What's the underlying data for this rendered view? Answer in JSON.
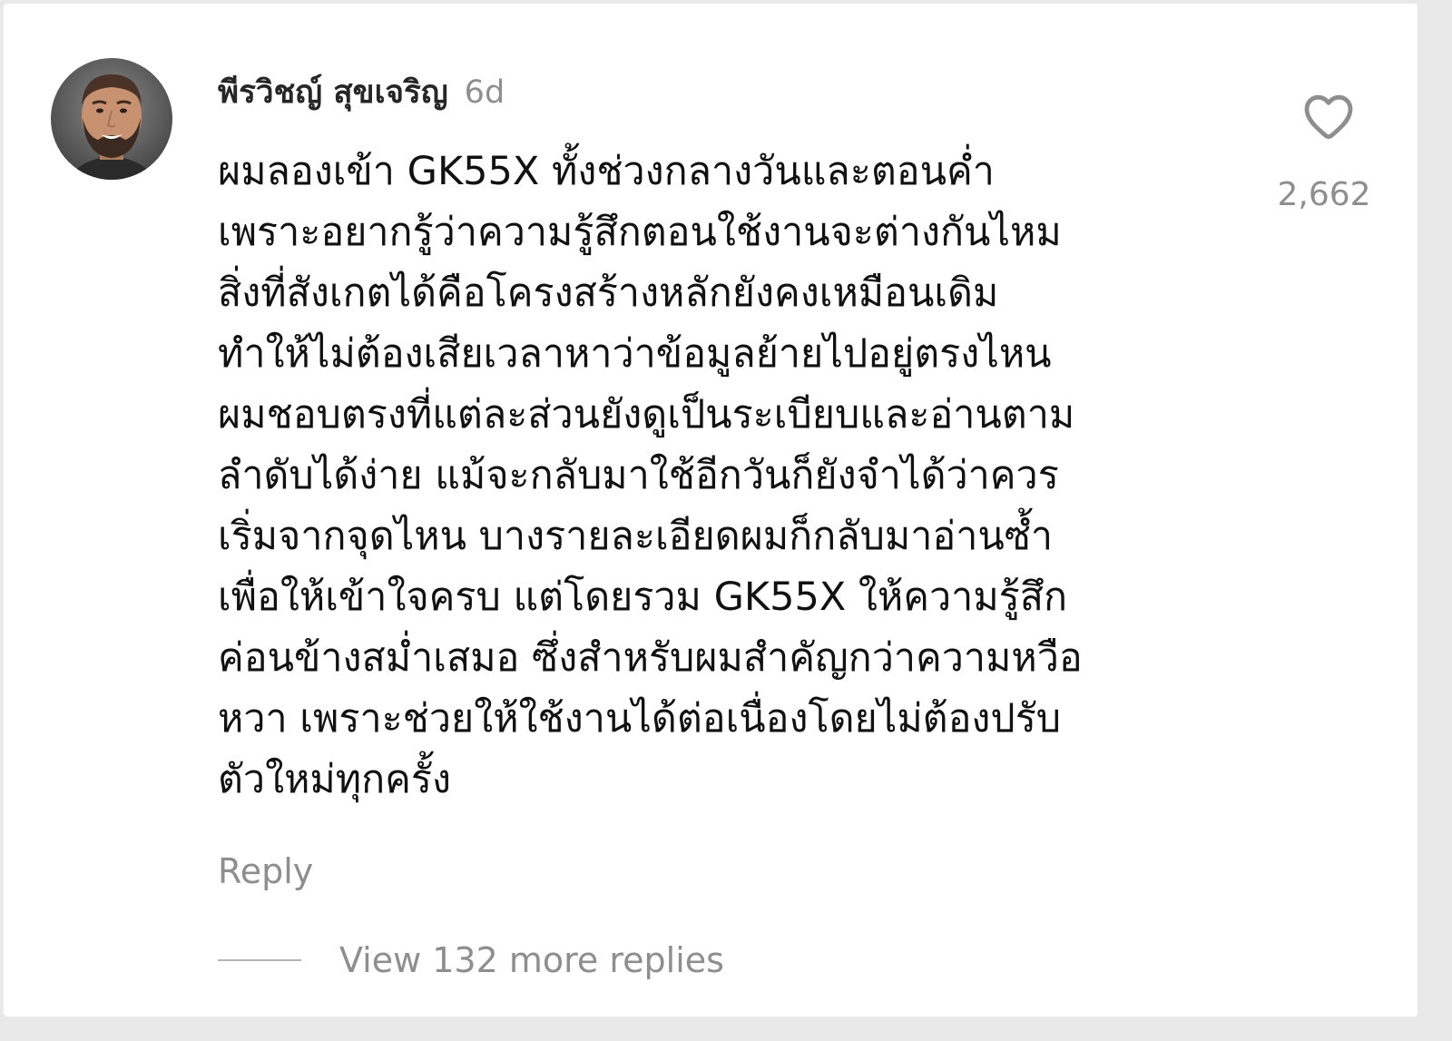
{
  "comment": {
    "avatar_icon": "user-avatar-photo",
    "username": "พีรวิชญ์ สุขเจริญ",
    "timestamp": "6d",
    "text": "ผมลองเข้า GK55X ทั้งช่วงกลางวันและตอนค่ำ\nเพราะอยากรู้ว่าความรู้สึกตอนใช้งานจะต่างกันไหม\nสิ่งที่สังเกตได้คือโครงสร้างหลักยังคงเหมือนเดิม\nทำให้ไม่ต้องเสียเวลาหาว่าข้อมูลย้ายไปอยู่ตรงไหน\nผมชอบตรงที่แต่ละส่วนยังดูเป็นระเบียบและอ่านตาม\nลำดับได้ง่าย แม้จะกลับมาใช้อีกวันก็ยังจำได้ว่าควร\nเริ่มจากจุดไหน บางรายละเอียดผมก็กลับมาอ่านซ้ำ\nเพื่อให้เข้าใจครบ แต่โดยรวม GK55X ให้ความรู้สึก\nค่อนข้างสม่ำเสมอ ซึ่งสำหรับผมสำคัญกว่าความหวือ\nหวา เพราะช่วยให้ใช้งานได้ต่อเนื่องโดยไม่ต้องปรับ\nตัวใหม่ทุกครั้ง",
    "like_icon": "heart-outline-icon",
    "like_count": "2,662",
    "reply_label": "Reply",
    "view_replies_label": "View 132 more replies"
  },
  "colors": {
    "primary_text": "#111111",
    "secondary_text": "#8e8e8e",
    "background": "#ffffff"
  }
}
